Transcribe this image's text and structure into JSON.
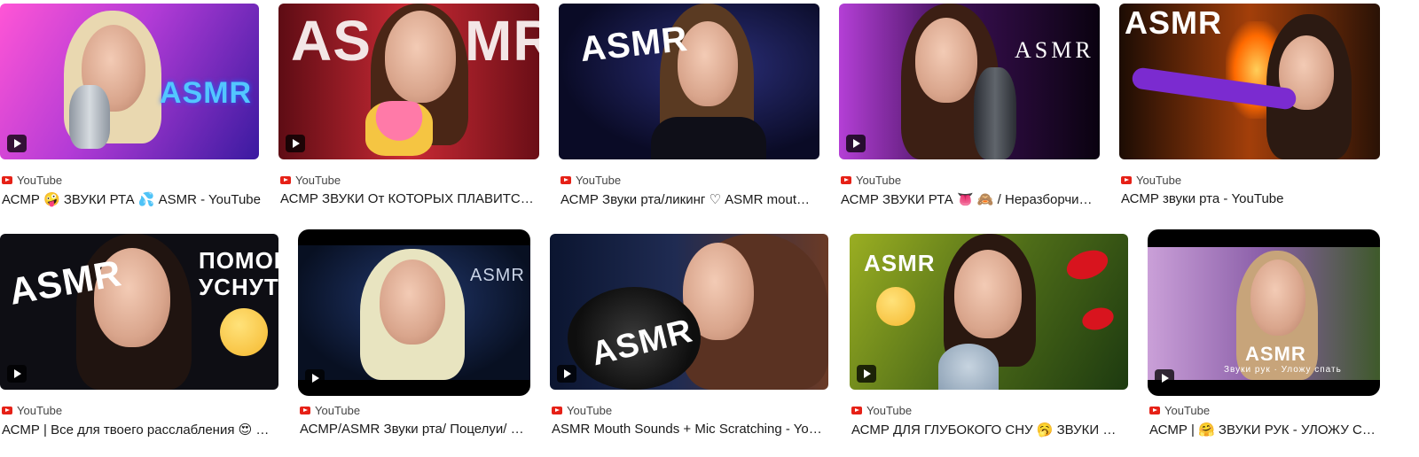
{
  "results": [
    {
      "source": "YouTube",
      "title": "АСМР 🤪 ЗВУКИ РТА 💦 ASMR - YouTube",
      "thumb_text": "ASMR",
      "colors": {
        "bg_from": "#ff4fd8",
        "bg_to": "#6a2bd1",
        "text": "#4ab8ff"
      }
    },
    {
      "source": "YouTube",
      "title": "АСМР ЗВУКИ От КОТОРЫХ ПЛАВИТСЯ МОЗГ",
      "thumb_text_left": "AS",
      "thumb_text_right": "MR",
      "colors": {
        "bg_from": "#d12a34",
        "bg_to": "#6d0f18",
        "text": "#ffffff"
      }
    },
    {
      "source": "YouTube",
      "title": "АСМР Звуки рта/ликинг ♡ ASMR mouth sounds",
      "thumb_text": "ASMR",
      "colors": {
        "bg_from": "#1a1c55",
        "bg_to": "#050618",
        "text": "#ffffff"
      }
    },
    {
      "source": "YouTube",
      "title": "АСМР ЗВУКИ РТА 👅 🙈 / Неразборчивый шепот",
      "thumb_text": "ASMR",
      "colors": {
        "bg_from": "#3b0f4a",
        "bg_to": "#0b0210",
        "text": "#ffffff"
      }
    },
    {
      "source": "YouTube",
      "title": "АСМР звуки рта - YouTube",
      "thumb_text": "ASMR",
      "colors": {
        "bg_from": "#2a1306",
        "bg_to": "#9a3a0a",
        "text": "#ffffff"
      }
    },
    {
      "source": "YouTube",
      "title": "АСМР | Все для твоего расслабления 😍 …",
      "thumb_text": "ASMR",
      "thumb_text_right": "ПОМОГУ УСНУТЬ",
      "colors": {
        "bg_from": "#1b1b22",
        "bg_to": "#05050a",
        "text": "#ffffff"
      }
    },
    {
      "source": "YouTube",
      "title": "АСМР/ASMR Звуки рта/ Поцелуи/ Ушки",
      "thumb_text": "ASMR",
      "colors": {
        "bg_from": "#1a2a55",
        "bg_to": "#08112a",
        "text": "#c9d3e6"
      }
    },
    {
      "source": "YouTube",
      "title": "ASMR Mouth Sounds + Mic Scratching - YouTube",
      "thumb_text": "ASMR",
      "colors": {
        "bg_from": "#0e1a3c",
        "bg_to": "#3a2218",
        "text": "#ffffff"
      }
    },
    {
      "source": "YouTube",
      "title": "АСМР ДЛЯ ГЛУБОКОГО СНУ 🥱 ЗВУКИ РТА",
      "thumb_text": "ASMR",
      "colors": {
        "bg_from": "#6b8a1c",
        "bg_to": "#2c4610",
        "text": "#ffffff"
      }
    },
    {
      "source": "YouTube",
      "title": "АСМР | 🤗 ЗВУКИ РУК - УЛОЖУ СПАТЬ",
      "thumb_text": "ASMR",
      "thumb_caption": "Звуки рук · Уложу спать",
      "colors": {
        "bg_from": "#c98ad6",
        "bg_to": "#5b3a72",
        "text": "#ffffff"
      }
    }
  ],
  "icons": {
    "source": "youtube-icon",
    "play": "play-icon"
  }
}
